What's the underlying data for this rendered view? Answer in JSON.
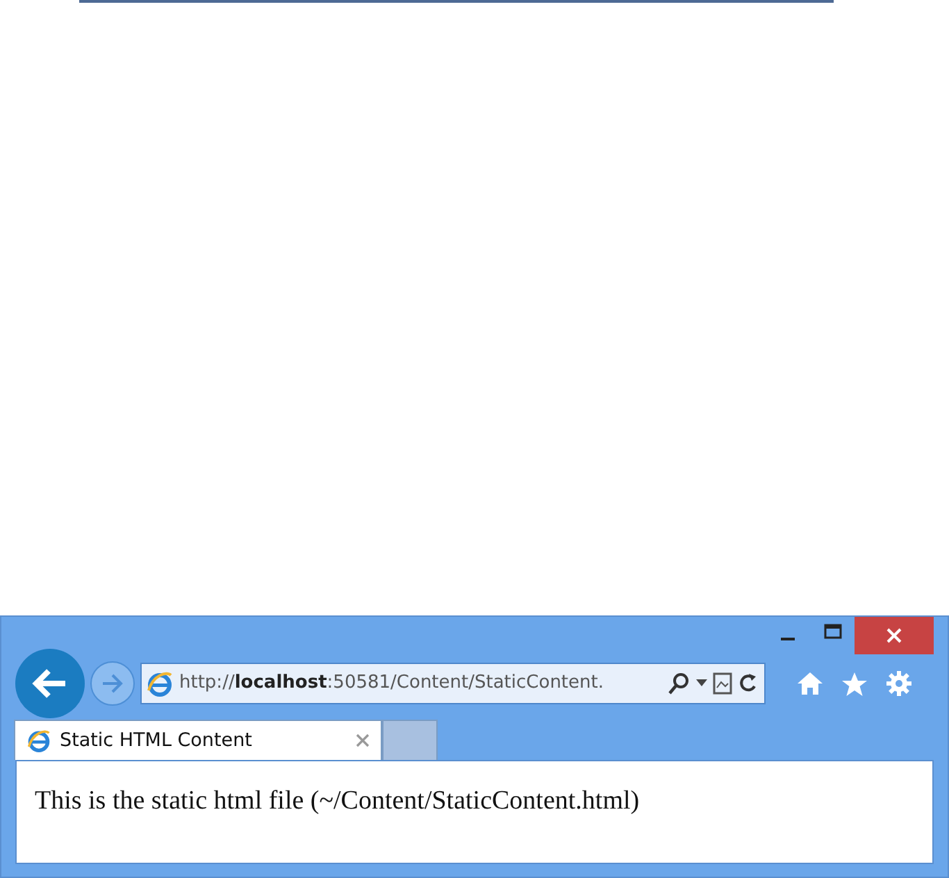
{
  "browser": {
    "address_bar": {
      "url": "http://**localhost**:50581/Content/StaticContent."
    },
    "tabs": [
      {
        "label": "Static HTML Content",
        "selected": true
      }
    ],
    "page": {
      "text": "This is the static html file (~/Content/StaticContent.html)"
    }
  }
}
